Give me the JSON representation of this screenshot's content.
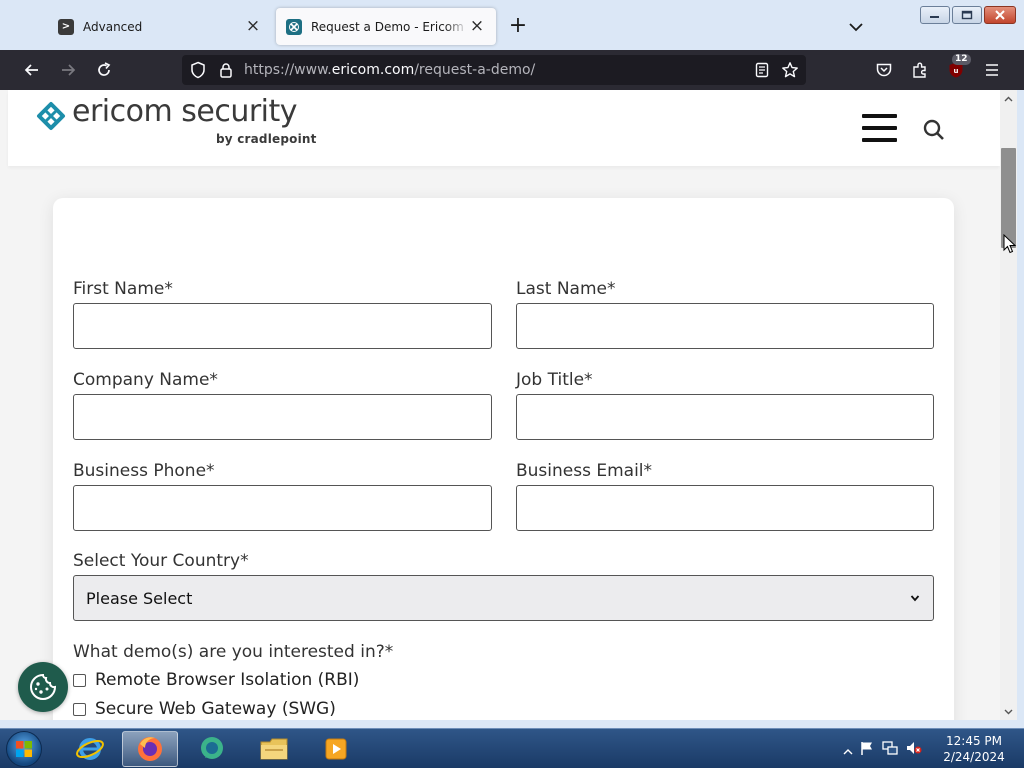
{
  "browser": {
    "tabs": [
      {
        "title": "Advanced",
        "active": false
      },
      {
        "title": "Request a Demo - Ericom Software",
        "active": true
      }
    ],
    "url": {
      "prefix": "https://www.",
      "domain": "ericom.com",
      "path": "/request-a-demo/"
    },
    "extension_badge": "12"
  },
  "site": {
    "logo_text": "ericom security",
    "logo_subtext": "by cradlepoint"
  },
  "form": {
    "fields": {
      "first_name": {
        "label": "First Name*",
        "value": ""
      },
      "last_name": {
        "label": "Last Name*",
        "value": ""
      },
      "company_name": {
        "label": "Company Name*",
        "value": ""
      },
      "job_title": {
        "label": "Job Title*",
        "value": ""
      },
      "business_phone": {
        "label": "Business Phone*",
        "value": ""
      },
      "business_email": {
        "label": "Business Email*",
        "value": ""
      }
    },
    "country": {
      "label": "Select Your Country*",
      "selected": "Please Select"
    },
    "demos": {
      "label": "What demo(s) are you interested in?*",
      "options": [
        {
          "label": "Remote Browser Isolation (RBI)",
          "checked": false
        },
        {
          "label": "Secure Web Gateway (SWG)",
          "checked": false
        }
      ]
    }
  },
  "taskbar": {
    "clock": {
      "time": "12:45 PM",
      "date": "2/24/2024"
    }
  },
  "colors": {
    "brand_teal": "#1d8eaa",
    "cookie_button": "#1f5b4c",
    "toolbar_dark": "#2b2a33",
    "tabstrip": "#dbe7f6"
  }
}
